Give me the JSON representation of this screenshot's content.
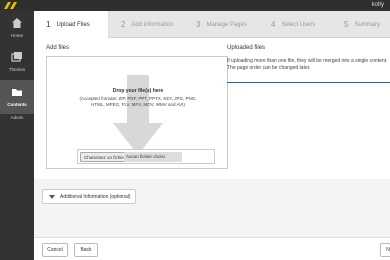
{
  "header": {
    "user": "kolty"
  },
  "sidebar": {
    "items": [
      {
        "label": "Home",
        "icon": "home-icon"
      },
      {
        "label": "Themes",
        "icon": "themes-icon"
      },
      {
        "label": "Contents",
        "icon": "contents-icon",
        "active": true
      },
      {
        "label": "Admin",
        "icon": "admin-icon"
      }
    ]
  },
  "tabs": [
    {
      "num": "1",
      "label": "Upload Files",
      "active": true
    },
    {
      "num": "2",
      "label": "Add information"
    },
    {
      "num": "3",
      "label": "Manage Pages"
    },
    {
      "num": "4",
      "label": "Select Users"
    },
    {
      "num": "5",
      "label": "Summary"
    }
  ],
  "upload": {
    "title": "Add files",
    "drop_title": "Drop your file(s) here",
    "drop_formats": "(Accepted formats: ZIP, PDF, PPT, PPTX, KEY, JPG, PNG, HTML, MPEG, FLV, MP4, MOV, WMV and AVI)",
    "choose_button": "Choisissez un fichier",
    "no_file": "Aucun fichier choisi"
  },
  "uploaded": {
    "title": "Uploaded files",
    "text": "If uploading more than one file, they will be merged into a single content. The page order can be changed later."
  },
  "additional": {
    "label": "Additional Information (optional)"
  },
  "footer": {
    "cancel": "Cancel",
    "back": "Back",
    "next": "N"
  },
  "colors": {
    "accent": "#3a5f7c",
    "sidebar": "#333333",
    "topbar": "#2f2f2f"
  }
}
